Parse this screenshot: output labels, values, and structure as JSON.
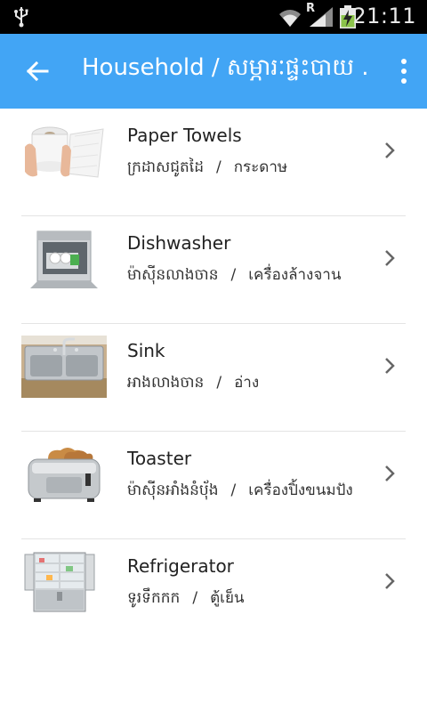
{
  "status_bar": {
    "time": "21:11",
    "roaming": "R",
    "icons": [
      "usb-icon",
      "wifi-icon",
      "signal-icon",
      "battery-charging-icon"
    ]
  },
  "app_bar": {
    "title": "Household / សម្ភារៈផ្ទះបាយ .",
    "back_icon": "arrow-back-icon",
    "menu_icon": "more-vert-icon",
    "color": "#42a5f5"
  },
  "items": [
    {
      "name": "Paper Towels",
      "khmer": "ក្រដាសជូតដៃ",
      "sep": "/",
      "thai": "กระดาษ",
      "icon": "paper-towels-image"
    },
    {
      "name": "Dishwasher",
      "khmer": "ម៉ាស៊ីនលាងចាន",
      "sep": "/",
      "thai": "เครื่องล้างจาน",
      "icon": "dishwasher-image"
    },
    {
      "name": "Sink",
      "khmer": "អាងលាងចាន",
      "sep": "/",
      "thai": "อ่าง",
      "icon": "sink-image"
    },
    {
      "name": "Toaster",
      "khmer": "ម៉ាស៊ីនអាំងនំបុ័ង",
      "sep": "/",
      "thai": "เครื่องปิ้งขนมปัง",
      "icon": "toaster-image"
    },
    {
      "name": "Refrigerator",
      "khmer": "ទូរទឹកកក",
      "sep": "/",
      "thai": "ตู้เย็น",
      "icon": "refrigerator-image"
    }
  ]
}
